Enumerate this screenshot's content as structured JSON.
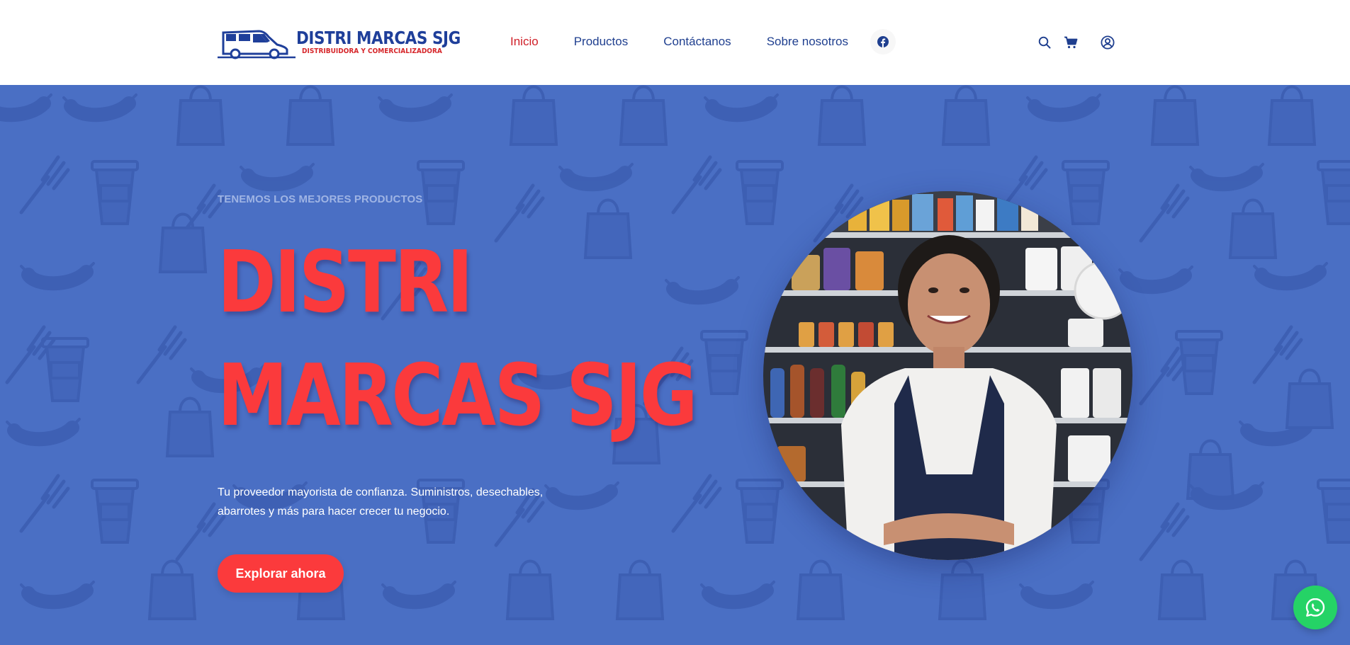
{
  "brand": {
    "name": "DISTRI MARCAS SJG",
    "tagline": "DISTRIBUIDORA Y COMERCIALIZADORA",
    "logo_icon": "delivery-van-icon"
  },
  "nav": {
    "items": [
      {
        "label": "Inicio",
        "active": true
      },
      {
        "label": "Productos",
        "active": false
      },
      {
        "label": "Contáctanos",
        "active": false
      },
      {
        "label": "Sobre nosotros",
        "active": false
      }
    ],
    "social_icon": "facebook-icon"
  },
  "toolbar": {
    "icons": [
      "search-icon",
      "cart-icon",
      "user-icon"
    ]
  },
  "hero": {
    "kicker": "TENEMOS LOS MEJORES PRODUCTOS",
    "title_line1": "DISTRI",
    "title_line2": "MARCAS SJG",
    "description": "Tu proveedor mayorista de confianza. Suministros, desechables, abarrotes y más para hacer crecer tu negocio.",
    "cta_label": "Explorar ahora",
    "image_alt": "store-clerk-photo",
    "pattern_icons": [
      "sausage-icon",
      "shopping-bag-icon",
      "fork-icon",
      "coffee-cup-icon"
    ]
  },
  "floating": {
    "icon": "whatsapp-icon"
  },
  "colors": {
    "primary_blue": "#1f3f8f",
    "hero_bg": "#4a6fc4",
    "accent_red": "#fb3a3c",
    "active_red": "#d01f28",
    "whatsapp_green": "#25d366"
  }
}
